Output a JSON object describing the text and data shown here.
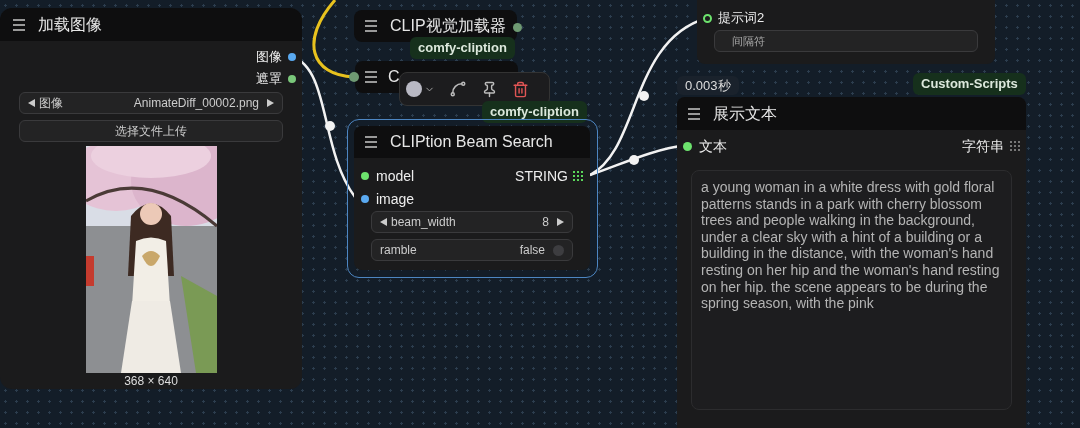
{
  "load_image_node": {
    "title": "加载图像",
    "outputs": [
      {
        "label": "图像",
        "color": "#5aa9f0"
      },
      {
        "label": "遮罩",
        "color": "#7ac77a"
      }
    ],
    "image_combo": {
      "label": "图像",
      "value": "AnimateDiff_00002.png"
    },
    "upload_button": "选择文件上传",
    "image_caption": "368 × 640"
  },
  "clip_vision_node": {
    "title": "CLIP视觉加载器",
    "badge": "comfy-cliption"
  },
  "hidden_node": {
    "title": "C"
  },
  "beam_search_node": {
    "title": "CLIPtion Beam Search",
    "selected": true,
    "badge": "comfy-cliption",
    "inputs": [
      {
        "label": "model",
        "color": "#6de36d"
      },
      {
        "label": "image",
        "color": "#5aa9f0"
      }
    ],
    "output": "STRING",
    "widgets": [
      {
        "kind": "number",
        "label": "beam_width",
        "value": "8"
      },
      {
        "kind": "toggle",
        "label": "ramble",
        "value": "false",
        "on": false
      }
    ]
  },
  "prompt_node": {
    "input": "提示词2",
    "field": {
      "placeholder": "间隔符"
    }
  },
  "show_text_node": {
    "timing": "0.003秒",
    "badge": "Custom-Scripts",
    "title": "展示文本",
    "input": "文本",
    "output": "字符串",
    "text": "a young woman in a white dress with gold floral patterns stands in a park with cherry blossom trees and people walking in the background, under a clear sky with a hint of a building or a building in the distance, with the woman's hand resting on her hip and the woman's hand resting on her hip. the scene appears to be during the spring season, with the pink"
  }
}
